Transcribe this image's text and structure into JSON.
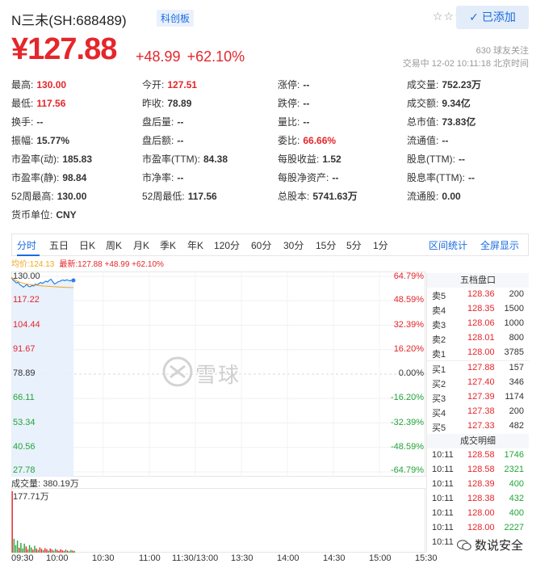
{
  "header": {
    "stock_name": "N三未(SH:688489)",
    "board_tag": "科创板",
    "star_label": "☆☆☆",
    "add_button_label": "已添加"
  },
  "price": {
    "current": "¥127.88",
    "change": "+48.99",
    "change_pct": "+62.10%",
    "followers": "630 球友关注",
    "trade_time": "交易中 12-02 10:11:18 北京时间"
  },
  "quote": [
    [
      {
        "label": "最高:",
        "value": "130.00",
        "color": "red"
      },
      {
        "label": "今开:",
        "value": "127.51",
        "color": "red"
      },
      {
        "label": "涨停:",
        "value": "--",
        "color": ""
      },
      {
        "label": "成交量:",
        "value": "752.23万",
        "color": ""
      }
    ],
    [
      {
        "label": "最低:",
        "value": "117.56",
        "color": "red"
      },
      {
        "label": "昨收:",
        "value": "78.89",
        "color": ""
      },
      {
        "label": "跌停:",
        "value": "--",
        "color": ""
      },
      {
        "label": "成交额:",
        "value": "9.34亿",
        "color": ""
      }
    ],
    [
      {
        "label": "换手:",
        "value": "--",
        "color": ""
      },
      {
        "label": "盘后量:",
        "value": "--",
        "color": ""
      },
      {
        "label": "量比:",
        "value": "--",
        "color": ""
      },
      {
        "label": "总市值:",
        "value": "73.83亿",
        "color": ""
      }
    ],
    [
      {
        "label": "振幅:",
        "value": "15.77%",
        "color": ""
      },
      {
        "label": "盘后额:",
        "value": "--",
        "color": ""
      },
      {
        "label": "委比:",
        "value": "66.66%",
        "color": "red"
      },
      {
        "label": "流通值:",
        "value": "--",
        "color": ""
      }
    ],
    [
      {
        "label": "市盈率(动):",
        "value": "185.83",
        "color": ""
      },
      {
        "label": "市盈率(TTM):",
        "value": "84.38",
        "color": ""
      },
      {
        "label": "每股收益:",
        "value": "1.52",
        "color": ""
      },
      {
        "label": "股息(TTM):",
        "value": "--",
        "color": ""
      }
    ],
    [
      {
        "label": "市盈率(静):",
        "value": "98.84",
        "color": ""
      },
      {
        "label": "市净率:",
        "value": "--",
        "color": ""
      },
      {
        "label": "每股净资产:",
        "value": "--",
        "color": ""
      },
      {
        "label": "股息率(TTM):",
        "value": "--",
        "color": ""
      }
    ],
    [
      {
        "label": "52周最高:",
        "value": "130.00",
        "color": ""
      },
      {
        "label": "52周最低:",
        "value": "117.56",
        "color": ""
      },
      {
        "label": "总股本:",
        "value": "5741.63万",
        "color": ""
      },
      {
        "label": "流通股:",
        "value": "0.00",
        "color": ""
      }
    ],
    [
      {
        "label": "货币单位:",
        "value": "CNY",
        "color": ""
      }
    ]
  ],
  "tabs": [
    "分时",
    "五日",
    "日K",
    "周K",
    "月K",
    "季K",
    "年K",
    "120分",
    "60分",
    "30分",
    "15分",
    "5分",
    "1分"
  ],
  "tab_right": [
    "区间统计",
    "全屏显示"
  ],
  "chart_info": {
    "avg": "均价:124.13",
    "latest": "最新:127.88 +48.99 +62.10%"
  },
  "chart_data": {
    "type": "line",
    "y_left_labels": [
      "130.00",
      "117.22",
      "104.44",
      "91.67",
      "78.89",
      "66.11",
      "53.34",
      "40.56",
      "27.78"
    ],
    "y_right_labels": [
      "64.79%",
      "48.59%",
      "32.39%",
      "16.20%",
      "0.00%",
      "-16.20%",
      "-32.39%",
      "-48.59%",
      "-64.79%"
    ],
    "x_labels": [
      "09:30",
      "10:00",
      "10:30",
      "11:00",
      "11:30/13:00",
      "13:30",
      "14:00",
      "14:30",
      "15:00",
      "15:30"
    ],
    "ylim": [
      27.78,
      130.0
    ],
    "price_series": [
      129.6,
      128.1,
      127.3,
      126.5,
      126.9,
      125.6,
      125.1,
      124.3,
      125.0,
      125.8,
      124.7,
      124.6,
      125.2,
      124.9,
      126.0,
      125.5,
      126.2,
      126.8,
      126.3,
      126.9,
      127.5,
      127.1,
      127.9,
      128.5,
      127.2,
      126.0,
      126.4,
      127.1,
      127.4,
      127.8,
      128.1,
      127.7,
      128.2,
      127.9,
      127.6,
      128.0,
      127.88
    ],
    "avg_series": [
      129.6,
      128.8,
      128.2,
      127.6,
      127.3,
      126.9,
      126.6,
      126.3,
      126.1,
      126.0,
      125.8,
      125.7,
      125.6,
      125.5,
      125.4,
      125.3,
      125.2,
      125.1,
      125.0,
      124.9,
      124.85,
      124.8,
      124.75,
      124.7,
      124.6,
      124.55,
      124.5,
      124.45,
      124.4,
      124.35,
      124.3,
      124.25,
      124.2,
      124.18,
      124.16,
      124.14,
      124.13
    ],
    "volume_label": "成交量: 380.19万",
    "volume_max_label": "177.71万",
    "volume_max": 177.71,
    "volumes": [
      177.71,
      40,
      22,
      35,
      14,
      28,
      12,
      26,
      18,
      10,
      22,
      15,
      9,
      20,
      12,
      8,
      15,
      11,
      7,
      13,
      10,
      6,
      12,
      9,
      6,
      11,
      8,
      5,
      10,
      7,
      5,
      9,
      6,
      4,
      8,
      6,
      5
    ]
  },
  "orderbook": {
    "title": "五档盘口",
    "rows": [
      {
        "side": "卖5",
        "price": "128.36",
        "qty": "200"
      },
      {
        "side": "卖4",
        "price": "128.35",
        "qty": "1500"
      },
      {
        "side": "卖3",
        "price": "128.06",
        "qty": "1000"
      },
      {
        "side": "卖2",
        "price": "128.01",
        "qty": "800"
      },
      {
        "side": "卖1",
        "price": "128.00",
        "qty": "3785"
      },
      {
        "side": "买1",
        "price": "127.88",
        "qty": "157"
      },
      {
        "side": "买2",
        "price": "127.40",
        "qty": "346"
      },
      {
        "side": "买3",
        "price": "127.39",
        "qty": "1174"
      },
      {
        "side": "买4",
        "price": "127.38",
        "qty": "200"
      },
      {
        "side": "买5",
        "price": "127.33",
        "qty": "482"
      }
    ]
  },
  "trades": {
    "title": "成交明细",
    "rows": [
      {
        "time": "10:11",
        "price": "128.58",
        "qty": "1746",
        "dir": "green"
      },
      {
        "time": "10:11",
        "price": "128.58",
        "qty": "2321",
        "dir": "green"
      },
      {
        "time": "10:11",
        "price": "128.39",
        "qty": "400",
        "dir": "green"
      },
      {
        "time": "10:11",
        "price": "128.38",
        "qty": "432",
        "dir": "green"
      },
      {
        "time": "10:11",
        "price": "128.00",
        "qty": "400",
        "dir": "green"
      },
      {
        "time": "10:11",
        "price": "128.00",
        "qty": "2227",
        "dir": "green"
      },
      {
        "time": "10:11",
        "price": "",
        "qty": "",
        "dir": "green"
      }
    ]
  },
  "watermark": "雪球",
  "wechat_label": "数说安全",
  "colors": {
    "up": "#e5262b",
    "down": "#22a538",
    "accent": "#1b6ce0",
    "avg": "#f0a61b"
  }
}
